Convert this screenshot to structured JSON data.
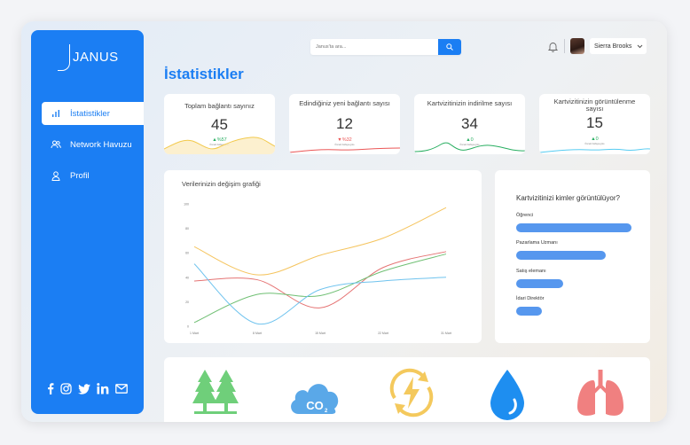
{
  "app": {
    "logo_text": "JANUS"
  },
  "sidebar": {
    "items": [
      {
        "label": "İstatistikler",
        "icon": "bar-chart-icon",
        "active": true
      },
      {
        "label": "Network Havuzu",
        "icon": "users-icon",
        "active": false
      },
      {
        "label": "Profil",
        "icon": "user-icon",
        "active": false
      }
    ],
    "socials": [
      "facebook-icon",
      "instagram-icon",
      "twitter-icon",
      "linkedin-icon",
      "mail-icon"
    ]
  },
  "header": {
    "search_placeholder": "Janus'ta ara...",
    "user_name": "Sierra Brooks"
  },
  "page_title": "İstatistikler",
  "stats": [
    {
      "title": "Toplam bağlantı sayınız",
      "value": "45",
      "delta": "▲%57",
      "sub": "Önceki haftaya göre",
      "color": "#f2c94c"
    },
    {
      "title": "Edindiğiniz yeni bağlantı sayısı",
      "value": "12",
      "delta": "▼%32",
      "sub": "Önceki haftaya göre",
      "color": "#eb5757"
    },
    {
      "title": "Kartvizitinizin indirilme sayısı",
      "value": "34",
      "delta": "▲0",
      "sub": "Önceki haftaya göre",
      "color": "#27ae60"
    },
    {
      "title": "Kartvizitinizin görüntülenme sayısı",
      "value": "15",
      "delta": "▲0",
      "sub": "Önceki haftaya göre",
      "color": "#56ccf2"
    }
  ],
  "chart": {
    "title": "Verilerinizin değişim grafiği"
  },
  "chart_data": {
    "type": "line",
    "title": "Verilerinizin değişim grafiği",
    "x": [
      "1 Mart",
      "8 Mart",
      "15 Mart",
      "22 Mart",
      "31 Mart"
    ],
    "ylim": [
      0,
      100
    ],
    "yticks": [
      0,
      20,
      40,
      60,
      80,
      100
    ],
    "series": [
      {
        "color": "#f5c45e",
        "values": [
          65,
          42,
          58,
          72,
          97
        ]
      },
      {
        "color": "#e57373",
        "values": [
          37,
          38,
          15,
          48,
          61
        ]
      },
      {
        "color": "#6fbf73",
        "values": [
          3,
          26,
          25,
          45,
          59
        ]
      },
      {
        "color": "#6fc3ee",
        "values": [
          51,
          2,
          30,
          37,
          40
        ]
      }
    ],
    "grid": false
  },
  "viewers": {
    "title": "Kartvizitinizi kimler görüntülüyor?",
    "rows": [
      {
        "label": "Öğrenci",
        "fraction": 1.0
      },
      {
        "label": "Pazarlama Uzmanı",
        "fraction": 0.78
      },
      {
        "label": "Satış elemanı",
        "fraction": 0.41
      },
      {
        "label": "İdari Direktör",
        "fraction": 0.22
      }
    ]
  },
  "impact_icons": [
    "trees-icon",
    "co2-cloud-icon",
    "energy-icon",
    "water-drop-icon",
    "lungs-icon"
  ]
}
